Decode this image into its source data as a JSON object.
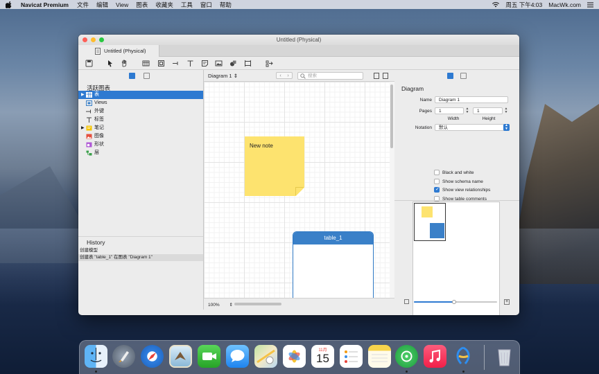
{
  "menubar": {
    "app_name": "Navicat Premium",
    "items": [
      "文件",
      "编辑",
      "View",
      "图表",
      "收藏夹",
      "工具",
      "窗口",
      "帮助"
    ],
    "clock": "周五 下午4:03",
    "site": "MacWk.com"
  },
  "window": {
    "title": "Untitled (Physical)",
    "tab_label": "Untitled (Physical)"
  },
  "toolbar": {
    "tools": [
      "save-icon",
      "pointer-icon",
      "hand-icon",
      "table-icon",
      "view-icon",
      "foreign-key-icon",
      "label-icon",
      "note-icon",
      "image-icon",
      "shape-icon",
      "layer-icon",
      "auto-layout-icon"
    ]
  },
  "sidebar": {
    "tree_title": "活跃图表",
    "items": [
      {
        "label": "表",
        "icon": "table-icon",
        "expandable": true
      },
      {
        "label": "Views",
        "icon": "view-icon",
        "expandable": false
      },
      {
        "label": "外键",
        "icon": "foreign-key-icon",
        "expandable": false
      },
      {
        "label": "标签",
        "icon": "label-icon",
        "expandable": false
      },
      {
        "label": "笔记",
        "icon": "note-icon",
        "expandable": true
      },
      {
        "label": "图像",
        "icon": "image-icon",
        "expandable": false
      },
      {
        "label": "形状",
        "icon": "shape-icon",
        "expandable": false
      },
      {
        "label": "层",
        "icon": "layer-icon",
        "expandable": false
      }
    ],
    "history_title": "History",
    "history": [
      "创建模型",
      "创建表 \"table_1\" 在图表 \"Diagram 1\""
    ]
  },
  "canvas": {
    "diagram_name": "Diagram 1",
    "search_placeholder": "搜索",
    "note_text": "New note",
    "table_name": "table_1",
    "zoom": "100%"
  },
  "inspector": {
    "title": "Diagram",
    "name_label": "Name",
    "name_value": "Diagram 1",
    "pages_label": "Pages",
    "pages_width": "1",
    "pages_height": "1",
    "width_label": "Width",
    "height_label": "Height",
    "notation_label": "Notation",
    "notation_value": "默认",
    "options": [
      {
        "label": "Black and white",
        "checked": false
      },
      {
        "label": "Show schema name",
        "checked": false
      },
      {
        "label": "Show view relationships",
        "checked": true
      },
      {
        "label": "Show table comments",
        "checked": false
      }
    ],
    "zoom_level": 0.48
  },
  "dock": {
    "apps": [
      "finder-icon",
      "launchpad-icon",
      "safari-icon",
      "mail-icon",
      "facetime-icon",
      "messages-icon",
      "maps-icon",
      "photos-icon",
      "calendar-icon",
      "reminders-icon",
      "notes-icon",
      "navicat-icon",
      "music-icon",
      "navicat-app-icon",
      "trash-icon"
    ],
    "calendar_month": "11月",
    "calendar_day": "15"
  },
  "colors": {
    "accent": "#2e7ad1",
    "note": "#fde36f",
    "table_header": "#3a80c8"
  }
}
